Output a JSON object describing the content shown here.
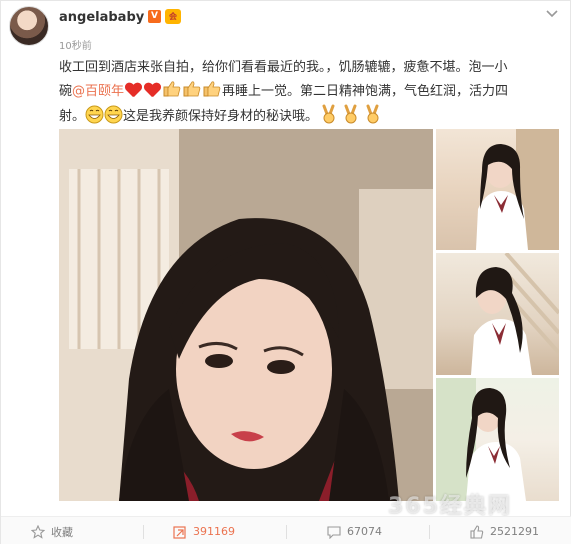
{
  "post": {
    "username": "angelababy",
    "vip_badge": "V",
    "member_badge": "会",
    "timestamp": "10秒前",
    "text_line1": "收工回到酒店来张自拍，给你们看看最近的我。，饥肠辘辘，疲惫不堪。泡一小",
    "text_line2_a": "碗",
    "text_line2_mention": "@百颐年",
    "text_line2_b": "再睡上一觉。第二日精神饱满，气色红润，活力四",
    "text_line3_a": "射。",
    "text_line3_b": "这是我养颜保持好身材的秘诀哦。",
    "watermark": "365经典网"
  },
  "actions": {
    "favorite_label": "收藏",
    "repost_count": "391169",
    "comment_count": "67074",
    "like_count": "2521291"
  },
  "colors": {
    "mention": "#eb7350",
    "heart": "#e52d27",
    "badge_v": "#f76b1c",
    "badge_member": "#ffb400"
  }
}
